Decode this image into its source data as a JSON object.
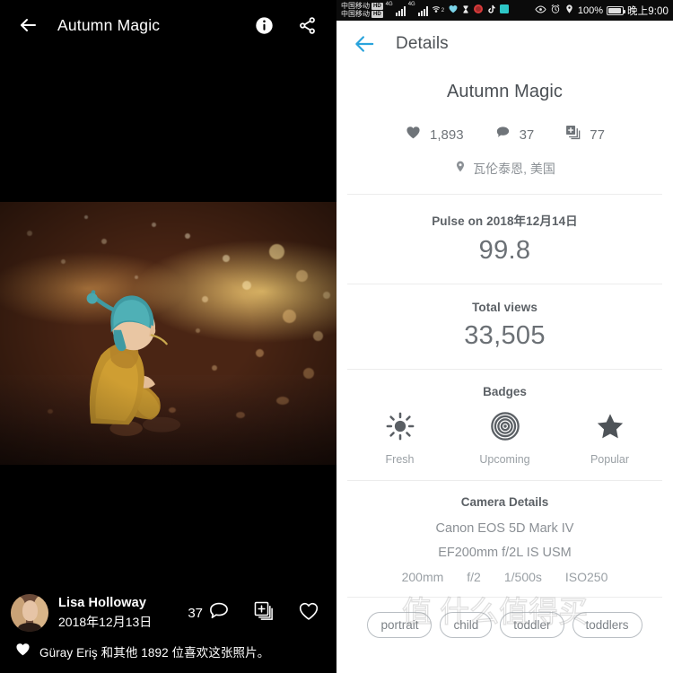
{
  "left_panel": {
    "topbar": {
      "back_icon": "arrow-left-icon",
      "title": "Autumn Magic",
      "info_icon": "info-icon",
      "share_icon": "share-icon"
    },
    "photo": {
      "alt": "Toddler in mustard knit outfit and teal bonnet sitting on ground with warm orange bokeh"
    },
    "footer": {
      "author_name": "Lisa Holloway",
      "author_date": "2018年12月13日",
      "comment_count": "37",
      "comment_icon": "comment-icon",
      "add-to-gallery_icon": "add-to-collection-icon",
      "like_icon": "heart-outline-icon",
      "likes_text": "Güray Eriş 和其他 1892 位喜欢这张照片。",
      "likes_heart_icon": "heart-filled-icon",
      "avatar_icon": "avatar"
    }
  },
  "right_panel": {
    "statusbar": {
      "carrier_line1": "中国移动",
      "carrier_line2": "中国移动",
      "hd_badge": "HD",
      "net1": "4G",
      "net2": "4G",
      "wifi_icon": "wifi-hotspot-icon",
      "wifi_sup": "2",
      "heart_icon": "heart-app-icon",
      "hourglass_icon": "hourglass-icon",
      "app1_icon": "red-circle-app-icon",
      "tiktok_icon": "tiktok-icon",
      "square_icon": "teal-square-app-icon",
      "eye_icon": "eye-icon",
      "alarm_icon": "alarm-clock-icon",
      "location_icon": "location-pin-icon",
      "battery_percent": "100%",
      "battery_icon": "battery-icon",
      "time": "晚上9:00"
    },
    "topbar": {
      "back_icon": "arrow-left-icon",
      "title": "Details"
    },
    "photo_title": "Autumn Magic",
    "stats": [
      {
        "icon": "heart-filled-icon",
        "value": "1,893"
      },
      {
        "icon": "comment-filled-icon",
        "value": "37"
      },
      {
        "icon": "add-to-collection-icon",
        "value": "77"
      }
    ],
    "location": {
      "icon": "location-pin-icon",
      "text": "瓦伦泰恩, 美国"
    },
    "pulse": {
      "label": "Pulse on 2018年12月14日",
      "value": "99.8"
    },
    "views": {
      "label": "Total views",
      "value": "33,505"
    },
    "badges": {
      "title": "Badges",
      "items": [
        {
          "icon": "sun-icon",
          "label": "Fresh"
        },
        {
          "icon": "concentric-rings-icon",
          "label": "Upcoming"
        },
        {
          "icon": "star-icon",
          "label": "Popular"
        }
      ]
    },
    "camera": {
      "title": "Camera Details",
      "body": "Canon EOS 5D Mark IV",
      "lens": "EF200mm f/2L IS USM",
      "specs": [
        "200mm",
        "f/2",
        "1/500s",
        "ISO250"
      ]
    },
    "tags": [
      "portrait",
      "child",
      "toddler",
      "toddlers"
    ],
    "watermark": "值 什么值得买"
  },
  "colors": {
    "accent_blue": "#29a3dc",
    "panel_bg": "#ffffff",
    "dark_bg": "#000000",
    "text_primary": "#4e5256",
    "text_secondary": "#8b9095",
    "divider": "#ececec"
  }
}
